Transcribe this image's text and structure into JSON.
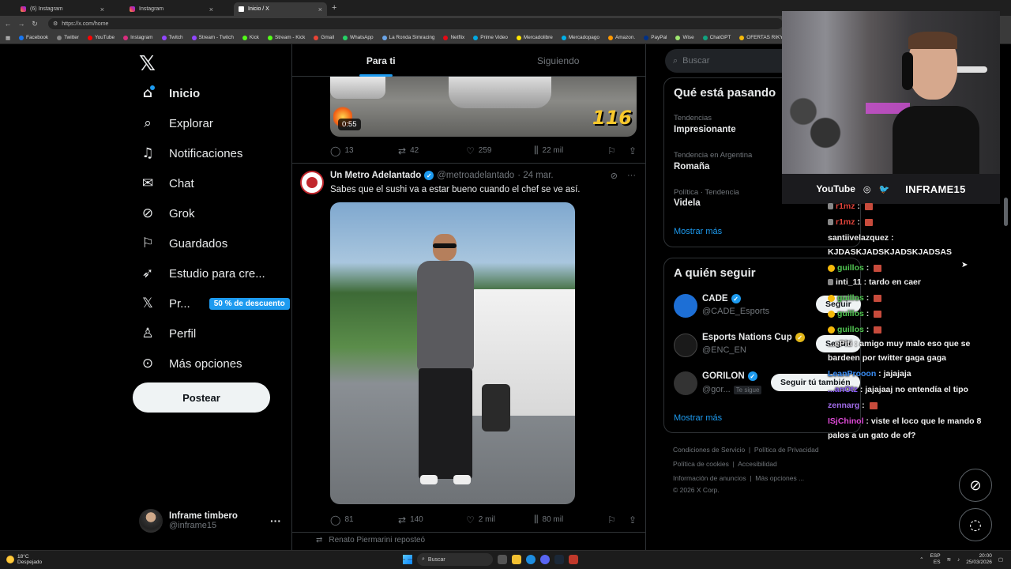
{
  "browser": {
    "tabs": [
      {
        "label": "(6) Instagram",
        "active": false
      },
      {
        "label": "Instagram",
        "active": false
      },
      {
        "label": "Inicio / X",
        "active": true
      }
    ],
    "url": "https://x.com/home",
    "bookmarks": [
      "Facebook",
      "Twitter",
      "YouTube",
      "Instagram",
      "Twitch",
      "Stream - Twitch",
      "Kick",
      "Stream - Kick",
      "Gmail",
      "WhatsApp",
      "La Ronda Simracing",
      "Netflix",
      "Prime Video",
      "Mercadolibre",
      "Mercadopago",
      "Amazon.",
      "PayPal",
      "Wise",
      "ChatGPT",
      "OFERTAS RIKY !"
    ]
  },
  "nav": {
    "items": [
      {
        "label": "Inicio",
        "icon": "home-icon"
      },
      {
        "label": "Explorar",
        "icon": "search-icon"
      },
      {
        "label": "Notificaciones",
        "icon": "bell-icon"
      },
      {
        "label": "Chat",
        "icon": "mail-icon"
      },
      {
        "label": "Grok",
        "icon": "grok-icon"
      },
      {
        "label": "Guardados",
        "icon": "bookmark-icon"
      },
      {
        "label": "Estudio para cre...",
        "icon": "rocket-icon"
      },
      {
        "label": "Pr...",
        "icon": "x-logo-icon"
      },
      {
        "label": "Perfil",
        "icon": "person-icon"
      },
      {
        "label": "Más opciones",
        "icon": "more-circle-icon"
      }
    ],
    "premium_badge": "50 % de descuento",
    "post_label": "Postear",
    "profile": {
      "name": "Inframe timbero",
      "handle": "@inframe15"
    }
  },
  "feed": {
    "tabs": [
      "Para ti",
      "Siguiendo"
    ],
    "tweet1": {
      "duration": "0:55",
      "video_text": "116",
      "replies": "13",
      "reposts": "42",
      "likes": "259",
      "views": "22 mil"
    },
    "tweet2": {
      "name": "Un Metro Adelantado",
      "handle": "@metroadelantado",
      "time": "· 24 mar.",
      "text": "Sabes que el sushi va a estar bueno cuando el chef se ve así.",
      "replies": "81",
      "reposts": "140",
      "likes": "2 mil",
      "views": "80 mil"
    },
    "repost_note": "Renato Piermarini reposteó"
  },
  "sidebar": {
    "search_placeholder": "Buscar",
    "trends_title": "Qué está pasando",
    "trends": [
      {
        "meta": "Tendencias",
        "name": "Impresionante"
      },
      {
        "meta": "Tendencia en Argentina",
        "name": "Romaña"
      },
      {
        "meta": "Política · Tendencia",
        "name": "Videla"
      }
    ],
    "show_more": "Mostrar más",
    "who_title": "A quién seguir",
    "who": [
      {
        "name": "CADE",
        "handle": "@CADE_Esports",
        "follow": "Seguir",
        "color": "#1d6fd6",
        "badge": "blue"
      },
      {
        "name": "Esports Nations Cup",
        "handle": "@ENC_EN",
        "follow": "Seguir",
        "color": "#1a1a1a",
        "badge": "gold"
      },
      {
        "name": "GORILON",
        "handle": "@gor...",
        "follows_you": "Te sigue",
        "follow": "Seguir tú también",
        "color": "#333",
        "badge": "blue"
      }
    ],
    "who_more": "Mostrar más",
    "footer": [
      "Condiciones de Servicio",
      "Política de Privacidad",
      "Política de cookies",
      "Accesibilidad",
      "Información de anuncios",
      "Más opciones ...",
      "© 2026 X Corp."
    ]
  },
  "stream": {
    "socials": [
      "YouTube"
    ],
    "channel": "INFRAME15"
  },
  "chat": [
    {
      "user": "r1mz",
      "text": "",
      "color": "#e0443b",
      "badge": "grey",
      "emote": true
    },
    {
      "user": "r1mz",
      "text": "",
      "color": "#e0443b",
      "badge": "grey",
      "emote": true
    },
    {
      "user": "santiivelazquez",
      "text": "KJDASKJADSKJADSKJADSAS",
      "color": "#f0f0f0",
      "badge": "none",
      "emote": false
    },
    {
      "user": "guillos",
      "text": "",
      "color": "#52c752",
      "badge": "gold",
      "emote": true
    },
    {
      "user": "inti_11",
      "text": "tardo en caer",
      "color": "#f0f0f0",
      "badge": "grey",
      "emote": false
    },
    {
      "user": "guillos",
      "text": "",
      "color": "#52c752",
      "badge": "gold",
      "emote": true
    },
    {
      "user": "guillos",
      "text": "",
      "color": "#52c752",
      "badge": "gold",
      "emote": true
    },
    {
      "user": "guillos",
      "text": "",
      "color": "#52c752",
      "badge": "gold",
      "emote": true
    },
    {
      "user": "...ePiti",
      "text": "amigo muy malo eso que se bardeen por twitter gaga gaga",
      "color": "#f0f0f0",
      "badge": "none",
      "emote": false
    },
    {
      "user": "LeanProoon",
      "text": "jajajaja",
      "color": "#3a8ef6",
      "badge": "none",
      "emote": false
    },
    {
      "user": "...anOtz",
      "text": "jajajaaj no entendía el tipo",
      "color": "#8a5cf6",
      "badge": "none",
      "emote": false
    },
    {
      "user": "zennarg",
      "text": "",
      "color": "#a06be8",
      "badge": "none",
      "emote": true
    },
    {
      "user": "ISjChinol",
      "text": "viste el loco que le mando 8 palos a un gato de of?",
      "color": "#e04bd8",
      "badge": "none",
      "emote": false
    }
  ],
  "taskbar": {
    "weather_temp": "18°C",
    "weather_desc": "Despejado",
    "search": "Buscar",
    "lang1": "ESP",
    "lang2": "ES",
    "time": "20:00",
    "date": "25/03/2026"
  },
  "colors": {
    "accent": "#1d9bf0",
    "bg": "#000000",
    "border": "#2f3336"
  }
}
